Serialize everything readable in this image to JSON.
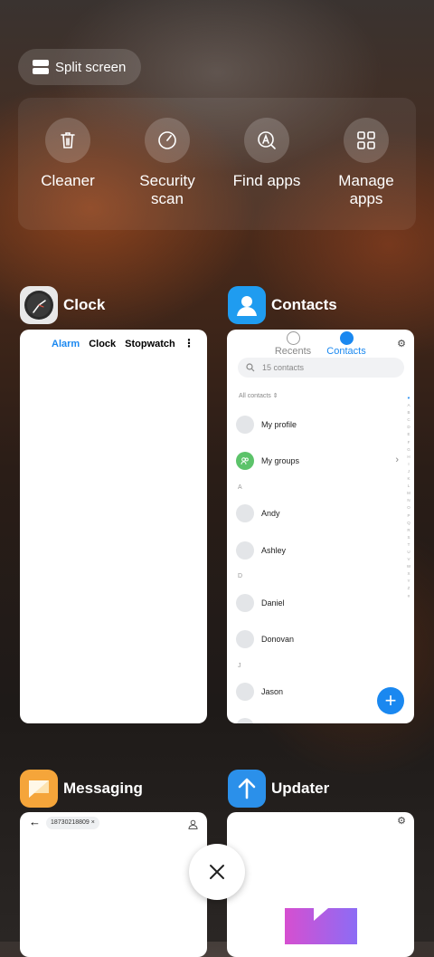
{
  "split_screen": {
    "label": "Split screen"
  },
  "quick_actions": [
    {
      "label": "Cleaner",
      "icon": "trash-icon"
    },
    {
      "label": "Security\nscan",
      "icon": "speedometer-icon"
    },
    {
      "label": "Find apps",
      "icon": "find-apps-icon"
    },
    {
      "label": "Manage\napps",
      "icon": "grid-icon"
    }
  ],
  "recent_apps": [
    {
      "name": "Clock",
      "icon": "clock-icon",
      "tabs": [
        "Alarm",
        "Clock",
        "Stopwatch"
      ],
      "active_tab": "Alarm"
    },
    {
      "name": "Contacts",
      "icon": "contacts-icon",
      "tabs": [
        "Recents",
        "Contacts"
      ],
      "active_tab": "Contacts",
      "search_placeholder": "15 contacts",
      "filter_label": "All contacts",
      "rows": [
        {
          "type": "item",
          "label": "My profile"
        },
        {
          "type": "item",
          "label": "My groups"
        },
        {
          "type": "section",
          "label": "A"
        },
        {
          "type": "item",
          "label": "Andy"
        },
        {
          "type": "item",
          "label": "Ashley"
        },
        {
          "type": "section",
          "label": "D"
        },
        {
          "type": "item",
          "label": "Daniel"
        },
        {
          "type": "item",
          "label": "Donovan"
        },
        {
          "type": "section",
          "label": "J"
        },
        {
          "type": "item",
          "label": "Jason"
        }
      ],
      "index_letters": [
        "♥",
        "A",
        "B",
        "C",
        "D",
        "E",
        "F",
        "G",
        "H",
        "I",
        "J",
        "K",
        "L",
        "M",
        "N",
        "O",
        "P",
        "Q",
        "R",
        "S",
        "T",
        "U",
        "V",
        "W",
        "X",
        "Y",
        "Z",
        "#"
      ]
    },
    {
      "name": "Messaging",
      "icon": "messaging-icon",
      "recipient": "18730218809"
    },
    {
      "name": "Updater",
      "icon": "updater-icon"
    }
  ],
  "colors": {
    "accent": "#1a88f0",
    "clock_icon_bg": "#e8e8e8",
    "contacts_icon_bg": "#1f9cf0",
    "messaging_icon_bg": "#f5a53a",
    "updater_icon_bg": "#2b90ea"
  }
}
